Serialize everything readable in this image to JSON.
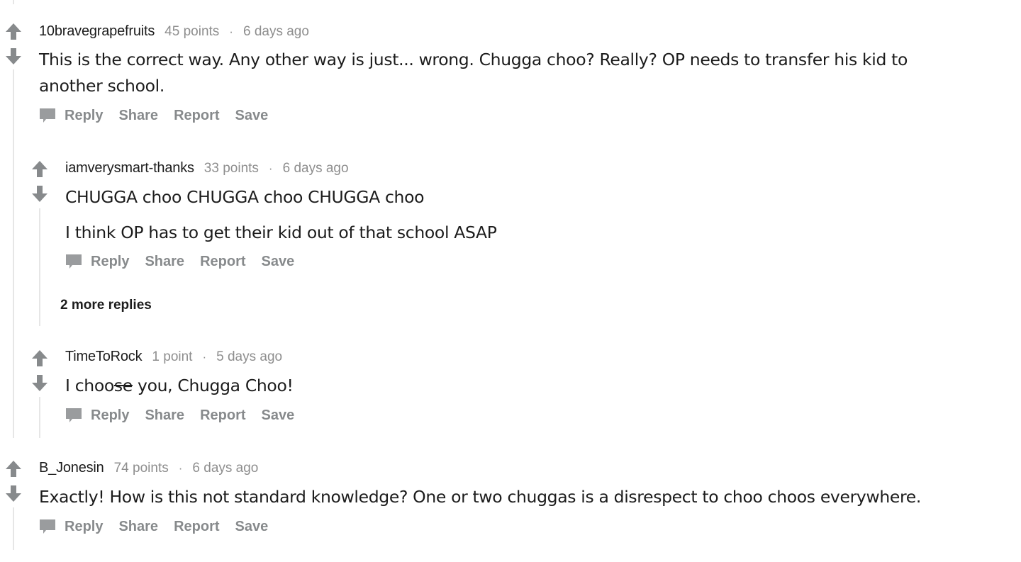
{
  "comments": [
    {
      "author": "10bravegrapefruits",
      "points": "45 points",
      "separator": "·",
      "time": "6 days ago",
      "body_line1": "This is the correct way. Any other way is just... wrong. Chugga choo? Really? OP needs to transfer his kid to",
      "body_line2": "another school.",
      "actions": {
        "reply": "Reply",
        "share": "Share",
        "report": "Report",
        "save": "Save"
      },
      "replies": [
        {
          "author": "iamverysmart-thanks",
          "points": "33 points",
          "separator": "·",
          "time": "6 days ago",
          "body_line1": "CHUGGA choo CHUGGA choo CHUGGA choo",
          "body_line2": "I think OP has to get their kid out of that school ASAP",
          "actions": {
            "reply": "Reply",
            "share": "Share",
            "report": "Report",
            "save": "Save"
          },
          "more_replies": "2 more replies"
        },
        {
          "author": "TimeToRock",
          "points": "1 point",
          "separator": "·",
          "time": "5 days ago",
          "body_pre": "I choo",
          "body_strike": "se",
          "body_post": " you, Chugga Choo!",
          "actions": {
            "reply": "Reply",
            "share": "Share",
            "report": "Report",
            "save": "Save"
          }
        }
      ]
    },
    {
      "author": "B_Jonesin",
      "points": "74 points",
      "separator": "·",
      "time": "6 days ago",
      "body_line1": "Exactly! How is this not standard knowledge? One or two chuggas is a disrespect to choo choos everywhere.",
      "actions": {
        "reply": "Reply",
        "share": "Share",
        "report": "Report",
        "save": "Save"
      }
    }
  ],
  "colors": {
    "vote_arrow": "#878a8c",
    "thread_line": "#e6e6e6",
    "meta_text": "#8e8e8e",
    "action_text": "#878a8c"
  }
}
